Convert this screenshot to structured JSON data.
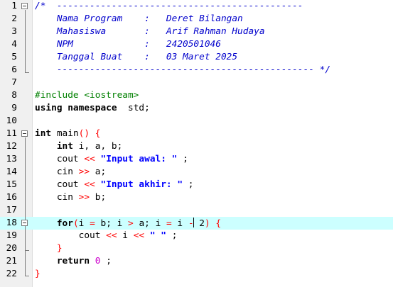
{
  "editor": {
    "lines": [
      {
        "n": "1",
        "t": [
          [
            "c",
            "/*  ---------------------------------------------"
          ]
        ]
      },
      {
        "n": "2",
        "t": [
          [
            "c",
            "    Nama Program    :   Deret Bilangan"
          ]
        ]
      },
      {
        "n": "3",
        "t": [
          [
            "c",
            "    Mahasiswa       :   Arif Rahman Hudaya"
          ]
        ]
      },
      {
        "n": "4",
        "t": [
          [
            "c",
            "    NPM             :   2420501046"
          ]
        ]
      },
      {
        "n": "5",
        "t": [
          [
            "c",
            "    Tanggal Buat    :   03 Maret 2025"
          ]
        ]
      },
      {
        "n": "6",
        "t": [
          [
            "c",
            "    ----------------------------------------------- */"
          ]
        ]
      },
      {
        "n": "7",
        "t": []
      },
      {
        "n": "8",
        "t": [
          [
            "pp",
            "#include <iostream>"
          ]
        ]
      },
      {
        "n": "9",
        "t": [
          [
            "kw",
            "using namespace"
          ],
          [
            "",
            "  std;"
          ]
        ]
      },
      {
        "n": "10",
        "t": []
      },
      {
        "n": "11",
        "t": [
          [
            "kw",
            "int"
          ],
          [
            "",
            " main"
          ],
          [
            "op",
            "()"
          ],
          [
            "",
            " "
          ],
          [
            "op",
            "{"
          ]
        ]
      },
      {
        "n": "12",
        "t": [
          [
            "",
            "    "
          ],
          [
            "kw",
            "int"
          ],
          [
            "",
            " i, a, b;"
          ]
        ]
      },
      {
        "n": "13",
        "t": [
          [
            "",
            "    cout "
          ],
          [
            "op",
            "<<"
          ],
          [
            "",
            " "
          ],
          [
            "str",
            "\"Input awal: \""
          ],
          [
            "",
            " ;"
          ]
        ]
      },
      {
        "n": "14",
        "t": [
          [
            "",
            "    cin "
          ],
          [
            "op",
            ">>"
          ],
          [
            "",
            " a;"
          ]
        ]
      },
      {
        "n": "15",
        "t": [
          [
            "",
            "    cout "
          ],
          [
            "op",
            "<<"
          ],
          [
            "",
            " "
          ],
          [
            "str",
            "\"Input akhir: \""
          ],
          [
            "",
            " ;"
          ]
        ]
      },
      {
        "n": "16",
        "t": [
          [
            "",
            "    cin "
          ],
          [
            "op",
            ">>"
          ],
          [
            "",
            " b;"
          ]
        ]
      },
      {
        "n": "17",
        "t": []
      },
      {
        "n": "18",
        "t": [
          [
            "",
            "    "
          ],
          [
            "kw",
            "for"
          ],
          [
            "op",
            "("
          ],
          [
            "",
            "i "
          ],
          [
            "op",
            "="
          ],
          [
            "",
            " b; i "
          ],
          [
            "op",
            ">"
          ],
          [
            "",
            " a; i "
          ],
          [
            "op",
            "="
          ],
          [
            "",
            " i "
          ],
          [
            "op",
            "-"
          ],
          [
            "caret",
            ""
          ],
          [
            "",
            " 2"
          ],
          [
            "op",
            ")"
          ],
          [
            "",
            " "
          ],
          [
            "op",
            "{"
          ]
        ],
        "active": true
      },
      {
        "n": "19",
        "t": [
          [
            "",
            "        cout "
          ],
          [
            "op",
            "<<"
          ],
          [
            "",
            " i "
          ],
          [
            "op",
            "<<"
          ],
          [
            "",
            " "
          ],
          [
            "str",
            "\" \""
          ],
          [
            "",
            " ;"
          ]
        ]
      },
      {
        "n": "20",
        "t": [
          [
            "",
            "    "
          ],
          [
            "op",
            "}"
          ]
        ]
      },
      {
        "n": "21",
        "t": [
          [
            "",
            "    "
          ],
          [
            "kw",
            "return"
          ],
          [
            "",
            " "
          ],
          [
            "num",
            "0"
          ],
          [
            "",
            " ;"
          ]
        ]
      },
      {
        "n": "22",
        "t": [
          [
            "op",
            "}"
          ]
        ]
      }
    ]
  }
}
